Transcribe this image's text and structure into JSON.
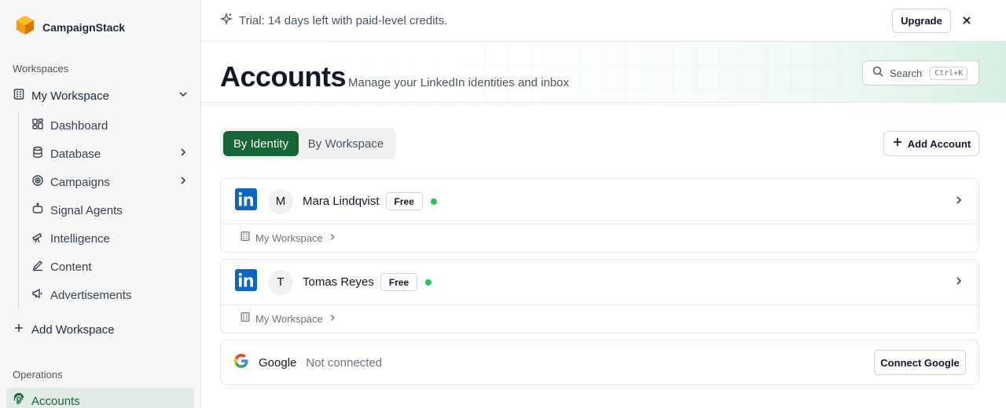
{
  "app": {
    "name": "CampaignStack",
    "logo_icon": "hexagon-logo-icon"
  },
  "sidebar": {
    "workspaces_label": "Workspaces",
    "workspace": {
      "label": "My Workspace",
      "icon": "building-icon"
    },
    "items": [
      {
        "label": "Dashboard",
        "icon": "grid-icon",
        "has_submenu": false
      },
      {
        "label": "Database",
        "icon": "database-icon",
        "has_submenu": true
      },
      {
        "label": "Campaigns",
        "icon": "target-icon",
        "has_submenu": true
      },
      {
        "label": "Signal Agents",
        "icon": "bot-icon",
        "has_submenu": false
      },
      {
        "label": "Intelligence",
        "icon": "telescope-icon",
        "has_submenu": false
      },
      {
        "label": "Content",
        "icon": "pen-icon",
        "has_submenu": false
      },
      {
        "label": "Advertisements",
        "icon": "megaphone-icon",
        "has_submenu": false
      }
    ],
    "add_workspace_label": "Add Workspace",
    "operations_label": "Operations",
    "active_item": {
      "label": "Accounts",
      "icon": "fingerprint-icon"
    }
  },
  "banner": {
    "message": "Trial: 14 days left with paid-level credits.",
    "upgrade_label": "Upgrade"
  },
  "header": {
    "title": "Accounts",
    "subtitle": "Manage your LinkedIn identities and inbox",
    "search_label": "Search",
    "search_shortcut": "Ctrl+K"
  },
  "view_toggle": {
    "options": [
      "By Identity",
      "By Workspace"
    ],
    "selected": "By Identity"
  },
  "add_account_label": "Add Account",
  "accounts": [
    {
      "initial": "M",
      "name": "Mara Lindqvist",
      "plan": "Free",
      "status": "online",
      "workspace": "My Workspace"
    },
    {
      "initial": "T",
      "name": "Tomas Reyes",
      "plan": "Free",
      "status": "online",
      "workspace": "My Workspace"
    }
  ],
  "google": {
    "name": "Google",
    "status": "Not connected",
    "connect_label": "Connect Google"
  },
  "colors": {
    "accent": "#166534",
    "active_bg": "#e3ebe6",
    "status_online": "#22c55e",
    "linkedin": "#0a66c2"
  }
}
